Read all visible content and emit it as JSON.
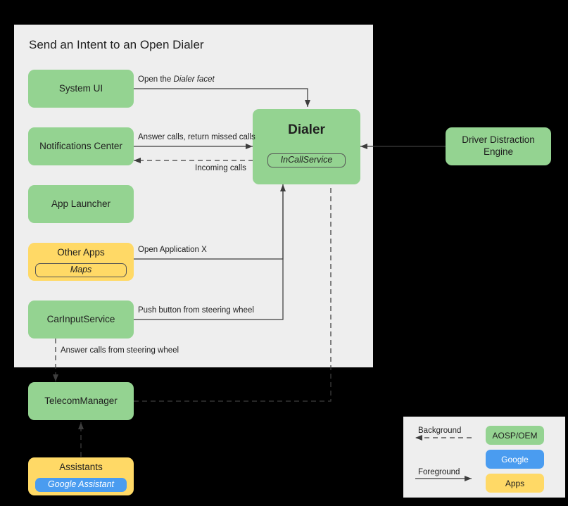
{
  "diagram": {
    "title": "Send an Intent to an Open Dialer",
    "colors": {
      "aosp_oem": "#94d391",
      "google": "#4a9cf0",
      "apps": "#ffd966",
      "panel_bg": "#eeeeee",
      "page_bg": "#000000",
      "line": "#3d3d3d"
    },
    "nodes": [
      {
        "id": "system-ui",
        "label": "System UI",
        "kind": "aosp_oem"
      },
      {
        "id": "notifications-center",
        "label": "Notifications Center",
        "kind": "aosp_oem"
      },
      {
        "id": "app-launcher",
        "label": "App Launcher",
        "kind": "aosp_oem"
      },
      {
        "id": "other-apps",
        "label": "Other Apps",
        "kind": "apps",
        "chip": "Maps",
        "chip_kind": "outline"
      },
      {
        "id": "car-input-service",
        "label": "CarInputService",
        "kind": "aosp_oem"
      },
      {
        "id": "dialer",
        "label": "Dialer",
        "kind": "aosp_oem",
        "chip": "InCallService",
        "chip_kind": "outline"
      },
      {
        "id": "driver-distraction-engine",
        "label": "Driver Distraction Engine",
        "kind": "aosp_oem"
      },
      {
        "id": "telecom-manager",
        "label": "TelecomManager",
        "kind": "aosp_oem"
      },
      {
        "id": "assistants",
        "label": "Assistants",
        "kind": "apps",
        "chip": "Google Assistant",
        "chip_kind": "google"
      }
    ],
    "edges": [
      {
        "id": "open-dialer-facet",
        "label_plain": "Open the ",
        "label_italic": "Dialer facet",
        "from": "system-ui",
        "to": "dialer",
        "style": "foreground"
      },
      {
        "id": "answer-return-calls",
        "label": "Answer calls, return missed calls",
        "from": "notifications-center",
        "to": "dialer",
        "style": "foreground"
      },
      {
        "id": "incoming-calls",
        "label": "Incoming calls",
        "from": "dialer",
        "to": "notifications-center",
        "style": "background"
      },
      {
        "id": "open-application-x",
        "label": "Open Application X",
        "from": "other-apps",
        "to": "dialer",
        "style": "foreground"
      },
      {
        "id": "push-button-steering",
        "label": "Push button from steering wheel",
        "from": "car-input-service",
        "to": "dialer",
        "style": "foreground"
      },
      {
        "id": "answer-calls-steering",
        "label": "Answer calls from steering wheel",
        "from": "car-input-service",
        "to": "telecom-manager",
        "style": "background"
      },
      {
        "id": "telecom-to-incallservice",
        "label": "",
        "from": "telecom-manager",
        "to": "dialer",
        "style": "background"
      },
      {
        "id": "assistants-to-telecom",
        "label": "",
        "from": "assistants",
        "to": "telecom-manager",
        "style": "background"
      },
      {
        "id": "dde-to-dialer",
        "label": "",
        "from": "driver-distraction-engine",
        "to": "dialer",
        "style": "foreground"
      }
    ]
  },
  "legend": {
    "background_label": "Background",
    "foreground_label": "Foreground",
    "keys": [
      {
        "id": "aosp-oem",
        "label": "AOSP/OEM"
      },
      {
        "id": "google",
        "label": "Google"
      },
      {
        "id": "apps",
        "label": "Apps"
      }
    ]
  }
}
